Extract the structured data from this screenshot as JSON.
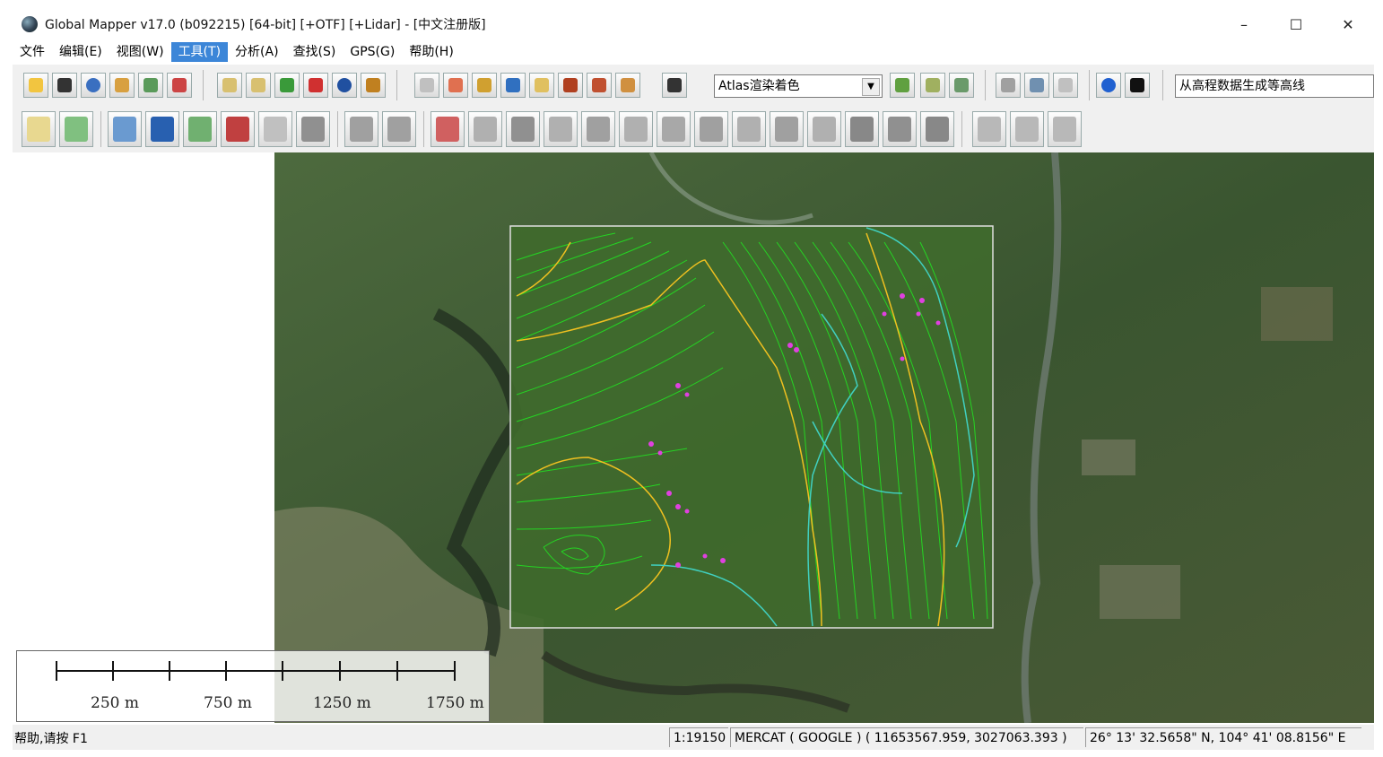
{
  "window": {
    "title": "Global Mapper v17.0 (b092215) [64-bit] [+OTF] [+Lidar] - [中文注册版]",
    "minimize": "–",
    "maximize": "☐",
    "close": "✕"
  },
  "menu": {
    "items": [
      "文件",
      "编辑(E)",
      "视图(W)",
      "工具(T)",
      "分析(A)",
      "查找(S)",
      "GPS(G)",
      "帮助(H)"
    ],
    "active": "工具(T)"
  },
  "toolbar": {
    "shader_combo": "Atlas渲染着色",
    "command_combo": "从高程数据生成等高线"
  },
  "scale": {
    "labels": [
      "250 m",
      "750 m",
      "1250 m",
      "1750 m"
    ]
  },
  "status": {
    "help": "帮助,请按 F1",
    "scale": "1:19150",
    "projection": "MERCAT ( GOOGLE ) ( 11653567.959, 3027063.393 )",
    "latlon": "26° 13' 32.5658\" N, 104° 41' 08.8156\" E"
  },
  "colors": {
    "contour_major": "#f0c020",
    "contour_minor": "#22e022",
    "stream": "#40d0c0",
    "points": "#e040e0",
    "menu_active": "#3c86d8"
  }
}
